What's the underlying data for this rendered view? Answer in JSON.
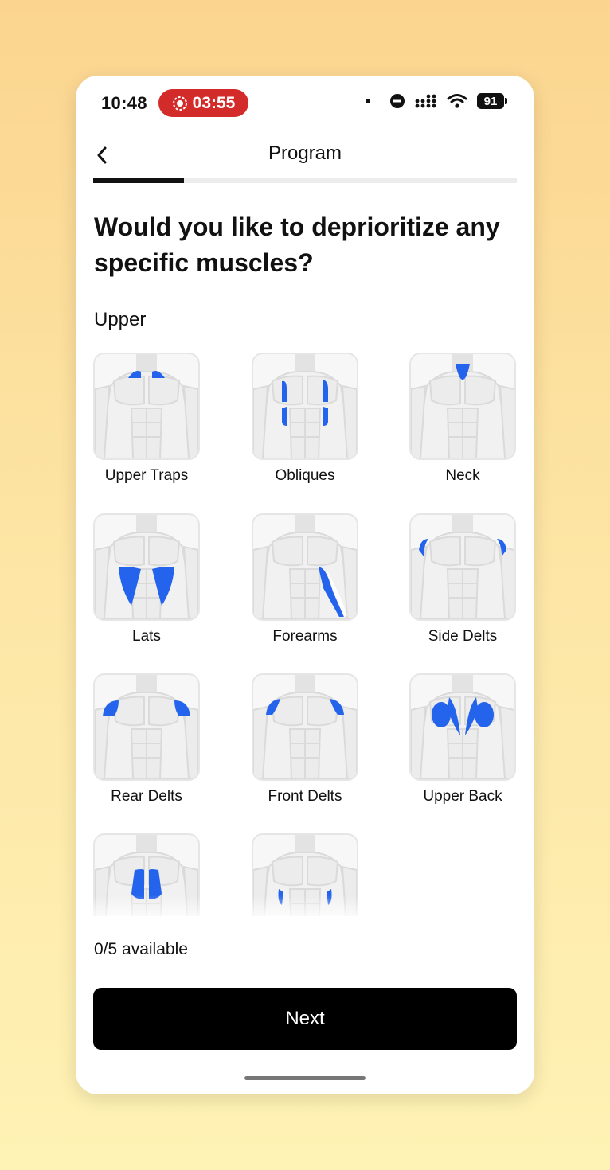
{
  "status": {
    "time": "10:48",
    "recording_timer": "03:55",
    "battery": "91"
  },
  "nav": {
    "title": "Program",
    "progress_fraction": 0.215
  },
  "question": "Would you like to deprioritize any specific muscles?",
  "section": "Upper",
  "muscles": [
    {
      "label": "Upper Traps",
      "icon": "upper-traps"
    },
    {
      "label": "Obliques",
      "icon": "obliques"
    },
    {
      "label": "Neck",
      "icon": "neck"
    },
    {
      "label": "Lats",
      "icon": "lats"
    },
    {
      "label": "Forearms",
      "icon": "forearms"
    },
    {
      "label": "Side Delts",
      "icon": "side-delts"
    },
    {
      "label": "Rear Delts",
      "icon": "rear-delts"
    },
    {
      "label": "Front Delts",
      "icon": "front-delts"
    },
    {
      "label": "Upper Back",
      "icon": "upper-back"
    },
    {
      "label": "",
      "icon": "lower-back"
    },
    {
      "label": "",
      "icon": "lower-abs"
    }
  ],
  "footer": {
    "available": "0/5 available",
    "next_label": "Next"
  },
  "colors": {
    "highlight": "#2463eb",
    "button": "#000000",
    "record": "#d32a2a"
  }
}
